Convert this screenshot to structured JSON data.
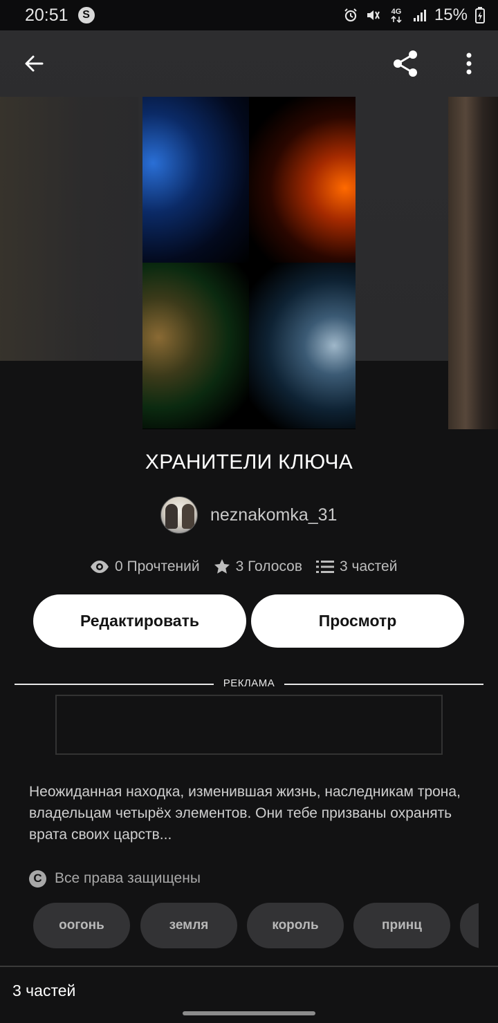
{
  "status_bar": {
    "time": "20:51",
    "s_glyph": "S",
    "network": "4G",
    "battery": "15%",
    "icons": [
      "alarm-icon",
      "mute-icon",
      "network-4g-icon",
      "signal-icon",
      "battery-charging-icon"
    ]
  },
  "toolbar": {
    "icons": [
      "back-arrow-icon",
      "share-icon",
      "more-vertical-icon"
    ]
  },
  "story": {
    "title": "ХРАНИТЕЛИ КЛЮЧА",
    "author": "neznakomka_31",
    "reads": "0 Прочтений",
    "votes": "3 Голосов",
    "parts": "3 частей",
    "description": "Неожиданная находка,  изменившая жизнь, наследникам трона, владельцам четырёх элементов. Они тебе призваны охранять врата своих царств...",
    "copyright": "Все права защищены",
    "copyright_glyph": "C"
  },
  "actions": {
    "edit_label": "Редактировать",
    "view_label": "Просмотр"
  },
  "ad": {
    "label": "РЕКЛАМА"
  },
  "tags": [
    "оогонь",
    "земля",
    "король",
    "принц"
  ],
  "footer": {
    "parts_count": "3 частей"
  },
  "colors": {
    "background": "#121213",
    "header_bg": "#2a2a2c",
    "button_bg": "#ffffff",
    "tag_bg": "#333335"
  }
}
